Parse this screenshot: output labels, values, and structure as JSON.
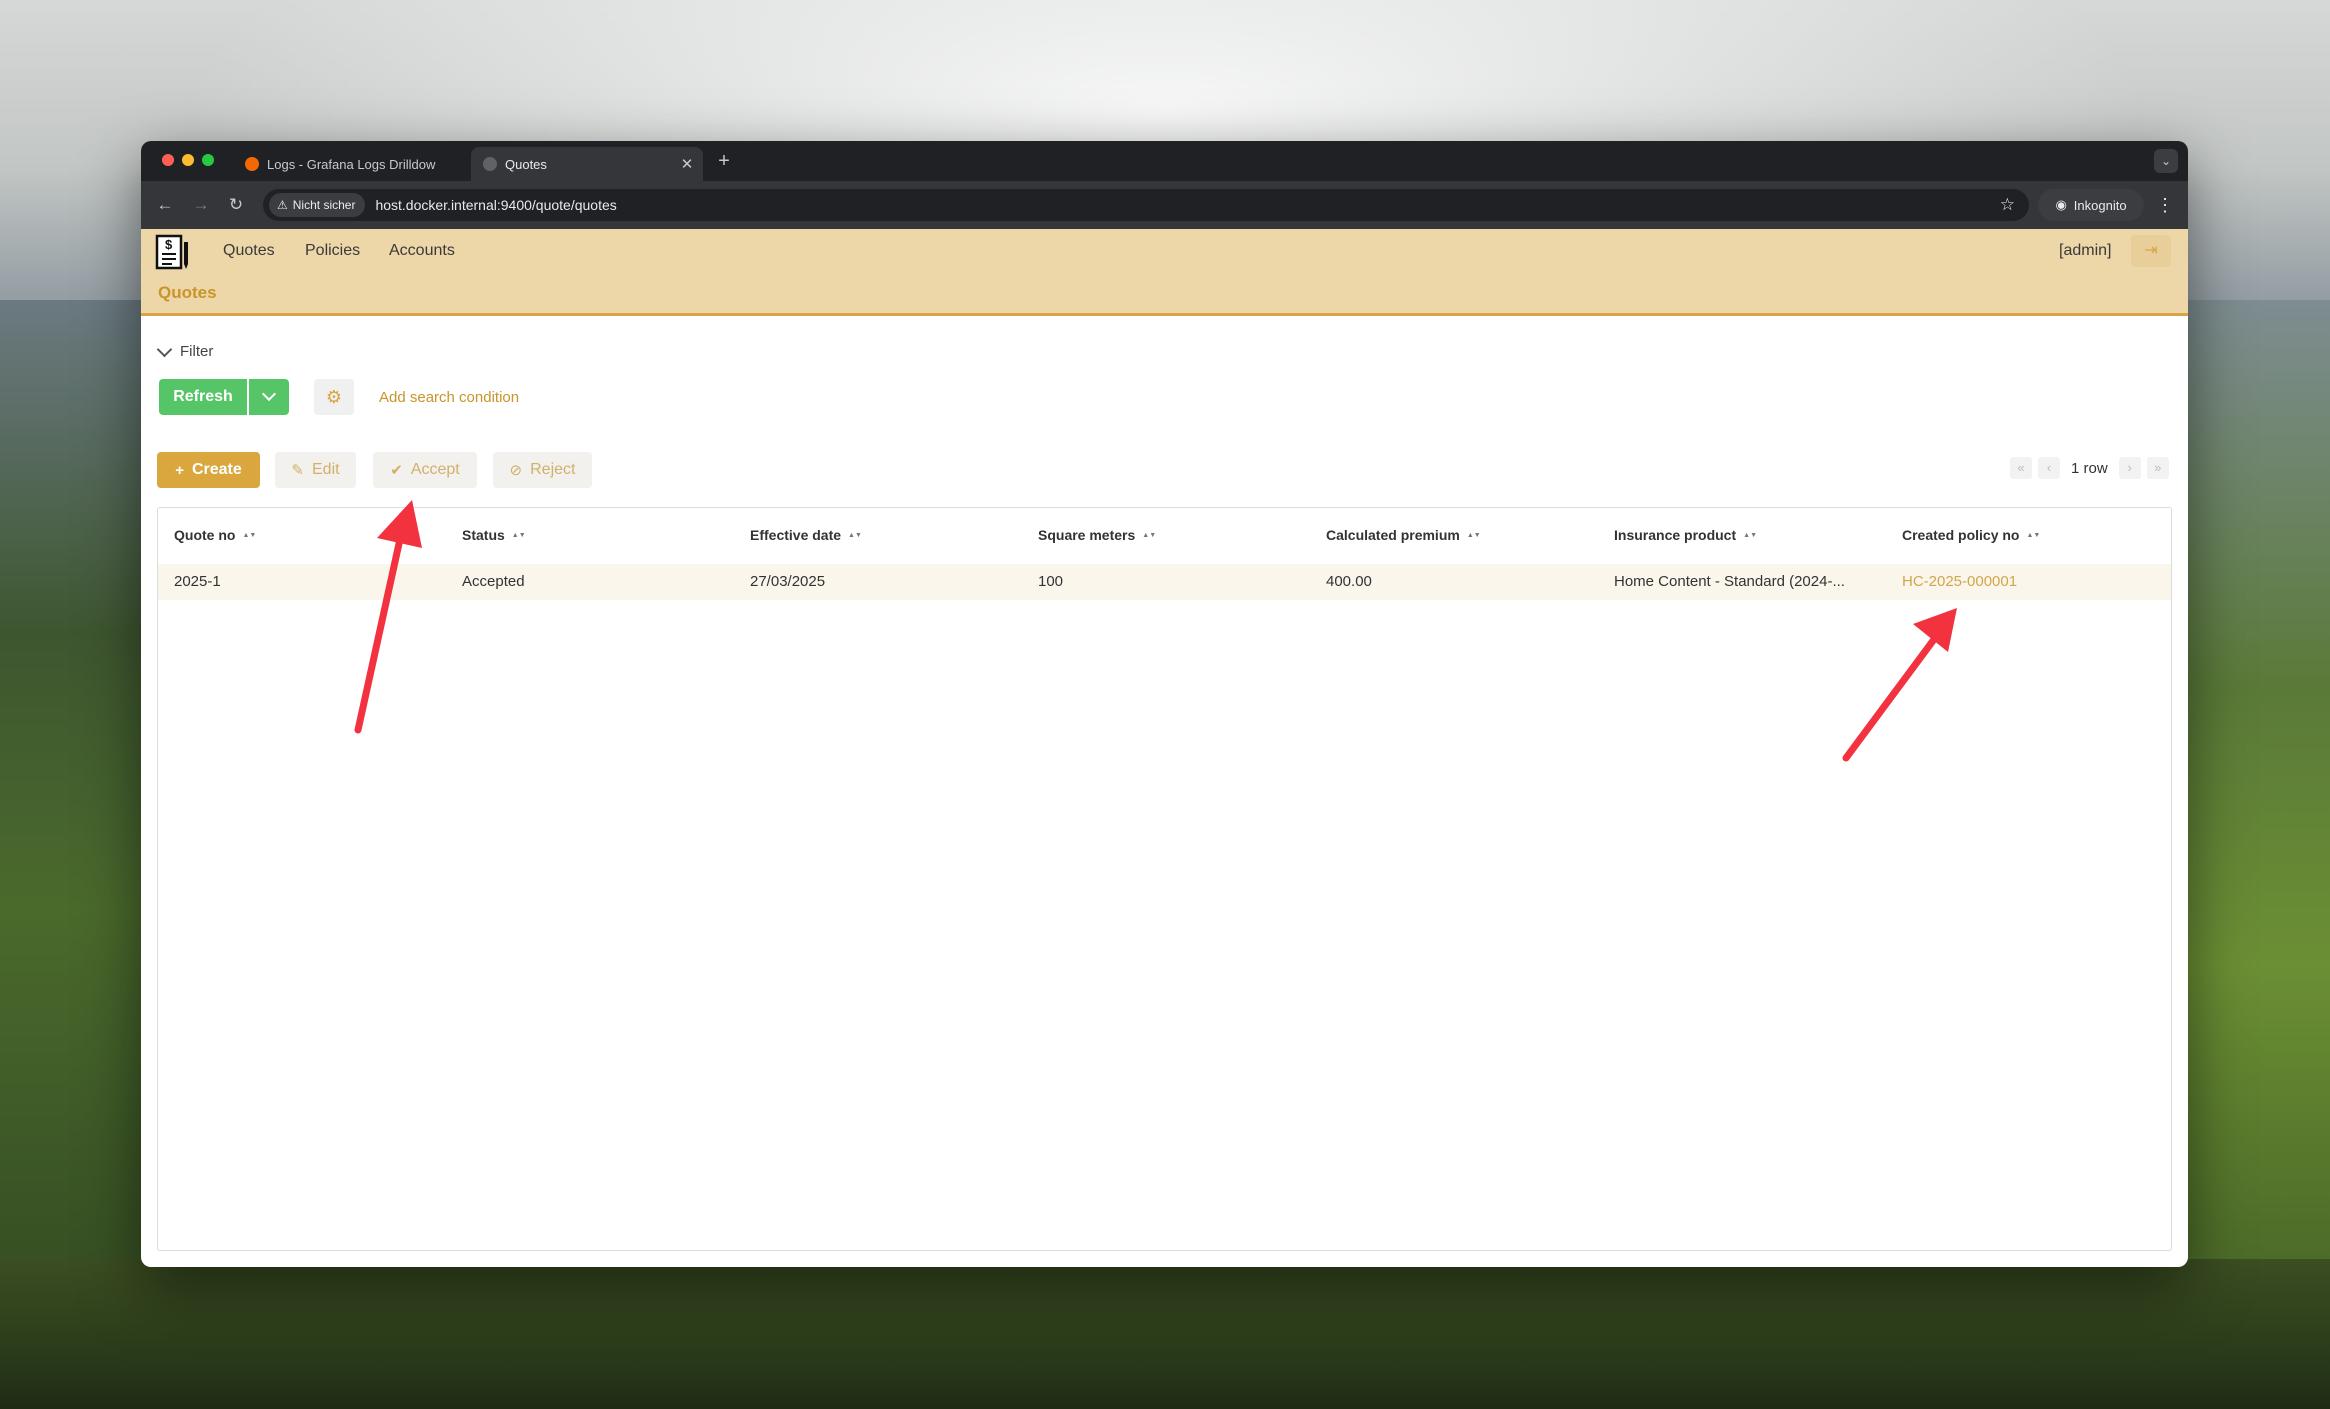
{
  "browser": {
    "tabs": [
      {
        "title": "Logs - Grafana Logs Drilldow",
        "active": false
      },
      {
        "title": "Quotes",
        "active": true
      }
    ],
    "security_label": "Nicht sicher",
    "url": "host.docker.internal:9400/quote/quotes",
    "incognito_label": "Inkognito"
  },
  "app": {
    "nav": [
      "Quotes",
      "Policies",
      "Accounts"
    ],
    "user": "[admin]",
    "page_title": "Quotes"
  },
  "filter": {
    "toggle_label": "Filter",
    "refresh_label": "Refresh",
    "add_condition_label": "Add search condition"
  },
  "actions": {
    "create": "Create",
    "edit": "Edit",
    "accept": "Accept",
    "reject": "Reject"
  },
  "pager": {
    "row_count": "1 row"
  },
  "table": {
    "columns": [
      "Quote no",
      "Status",
      "Effective date",
      "Square meters",
      "Calculated premium",
      "Insurance product",
      "Created policy no"
    ],
    "rows": [
      [
        "2025-1",
        "Accepted",
        "27/03/2025",
        "100",
        "400.00",
        "Home Content - Standard (2024-...",
        "HC-2025-000001"
      ]
    ]
  },
  "colors": {
    "header_bg": "#edd6a8",
    "accent": "#d9a73e",
    "refresh_green": "#55c567",
    "annotation_red": "#f2333f"
  }
}
